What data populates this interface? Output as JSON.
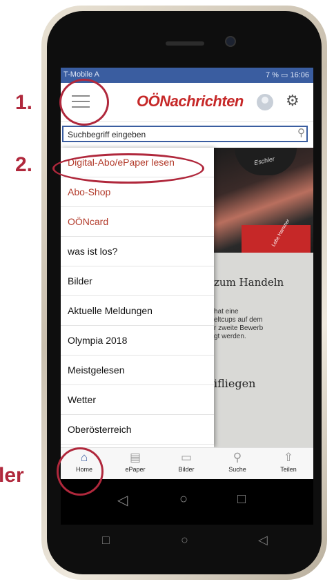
{
  "status_bar": {
    "carrier": "T-Mobile A",
    "right": "7 %",
    "time": "16:06"
  },
  "app_bar": {
    "logo_text": "OÖNachrichten",
    "menu_icon": "hamburger-icon",
    "profile_icon": "avatar-icon",
    "settings_icon": "gear-icon"
  },
  "search": {
    "placeholder": "Suchbegriff eingeben",
    "icon": "search-icon"
  },
  "drawer": {
    "items": [
      {
        "label": "Digital-Abo/ePaper lesen"
      },
      {
        "label": "Abo-Shop"
      },
      {
        "label": "OÖNcard"
      },
      {
        "label": "was ist los?"
      },
      {
        "label": "Bilder"
      },
      {
        "label": "Aktuelle Meldungen"
      },
      {
        "label": "Olympia 2018"
      },
      {
        "label": "Meistgelesen"
      },
      {
        "label": "Wetter"
      },
      {
        "label": "Oberösterreich"
      }
    ]
  },
  "content": {
    "hat_logo": "Eschler",
    "jersey_logo": "Lebe Hammer",
    "headline": "zum Handeln",
    "teaser_lines": [
      "hat eine",
      "eltcups auf dem",
      "r zweite Bewerb",
      "gt werden."
    ],
    "headline2": "ifliegen"
  },
  "bottom_nav": {
    "items": [
      {
        "label": "Home",
        "icon": "home-icon",
        "active": true
      },
      {
        "label": "ePaper",
        "icon": "epaper-icon"
      },
      {
        "label": "Bilder",
        "icon": "bilder-icon"
      },
      {
        "label": "Suche",
        "icon": "search-icon"
      },
      {
        "label": "Teilen",
        "icon": "share-icon"
      }
    ]
  },
  "annotations": {
    "callout_1": "1.",
    "callout_2": "2.",
    "callout_3": "ler"
  },
  "colors": {
    "accent": "#3a5da0",
    "brand_red": "#c62828",
    "annotation": "#b0283c"
  }
}
